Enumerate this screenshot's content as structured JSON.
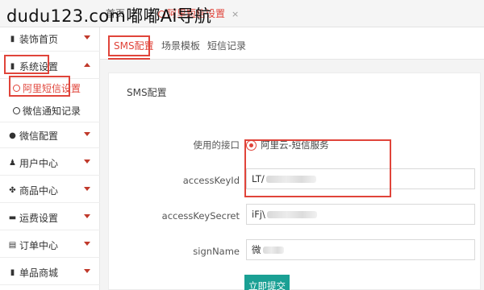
{
  "watermark": "dudu123.com嘟嘟Ai导航",
  "top_tabs": {
    "home": "首页",
    "active": "阿里短信设置",
    "close": "×"
  },
  "sidebar": {
    "items": [
      {
        "icon": "book-icon",
        "label": "装饰首页"
      },
      {
        "icon": "book-icon",
        "label": "系统设置",
        "expanded": true
      },
      {
        "icon": "wechat-icon",
        "label": "微信配置"
      },
      {
        "icon": "users-icon",
        "label": "用户中心"
      },
      {
        "icon": "cubes-icon",
        "label": "商品中心"
      },
      {
        "icon": "truck-icon",
        "label": "运费设置"
      },
      {
        "icon": "list-icon",
        "label": "订单中心"
      },
      {
        "icon": "book-icon",
        "label": "单品商城"
      }
    ],
    "subitems": [
      {
        "label": "阿里短信设置",
        "active": true
      },
      {
        "label": "微信通知记录",
        "active": false
      }
    ]
  },
  "subtabs": [
    "SMS配置",
    "场景模板",
    "短信记录"
  ],
  "panel": {
    "title": "SMS配置",
    "interface_label": "使用的接口",
    "interface_option": "阿里云-短信服务",
    "fields": [
      {
        "label": "accessKeyId",
        "value": "LT/"
      },
      {
        "label": "accessKeySecret",
        "value": "iFj\\"
      },
      {
        "label": "signName",
        "value": "微"
      }
    ],
    "submit": "立即提交"
  },
  "colors": {
    "accent": "#e0443a",
    "submit": "#1aa094"
  }
}
